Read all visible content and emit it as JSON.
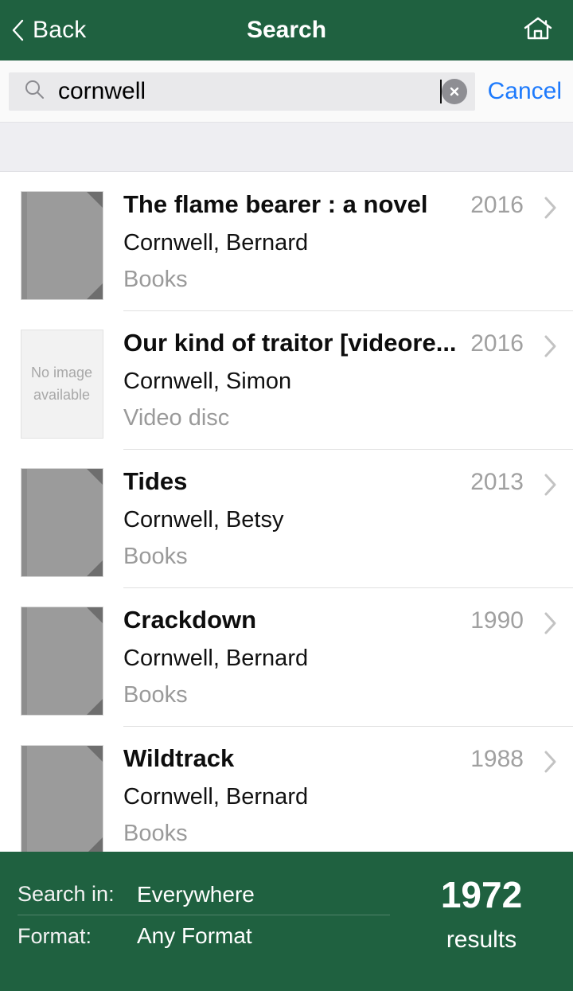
{
  "header": {
    "back_label": "Back",
    "title": "Search",
    "home_icon": "home-icon",
    "back_icon": "chevron-left-icon",
    "background_color": "#1f6140"
  },
  "search": {
    "value": "cornwell",
    "placeholder": "Search",
    "search_icon": "search-icon",
    "clear_icon": "clear-circle-icon",
    "cancel_label": "Cancel",
    "cancel_color": "#1d7afc",
    "field_background": "#e9e9eb"
  },
  "results": {
    "items": [
      {
        "title": "The flame bearer : a novel",
        "author": "Cornwell, Bernard",
        "format": "Books",
        "year": "2016",
        "thumb": "cover-placeholder",
        "thumb_text": ""
      },
      {
        "title": "Our kind of traitor [videore...",
        "author": "Cornwell, Simon",
        "format": "Video disc",
        "year": "2016",
        "thumb": "no-image",
        "thumb_text_line1": "No image",
        "thumb_text_line2": "available"
      },
      {
        "title": "Tides",
        "author": "Cornwell, Betsy",
        "format": "Books",
        "year": "2013",
        "thumb": "cover-placeholder",
        "thumb_text": ""
      },
      {
        "title": "Crackdown",
        "author": "Cornwell, Bernard",
        "format": "Books",
        "year": "1990",
        "thumb": "cover-placeholder",
        "thumb_text": ""
      },
      {
        "title": "Wildtrack",
        "author": "Cornwell, Bernard",
        "format": "Books",
        "year": "1988",
        "thumb": "cover-placeholder",
        "thumb_text": ""
      }
    ],
    "disclosure_icon": "chevron-right-icon"
  },
  "footer": {
    "search_in_label": "Search in:",
    "search_in_value": "Everywhere",
    "format_label": "Format:",
    "format_value": "Any Format",
    "result_count": "1972",
    "result_count_label": "results",
    "background_color": "#1f6140"
  }
}
